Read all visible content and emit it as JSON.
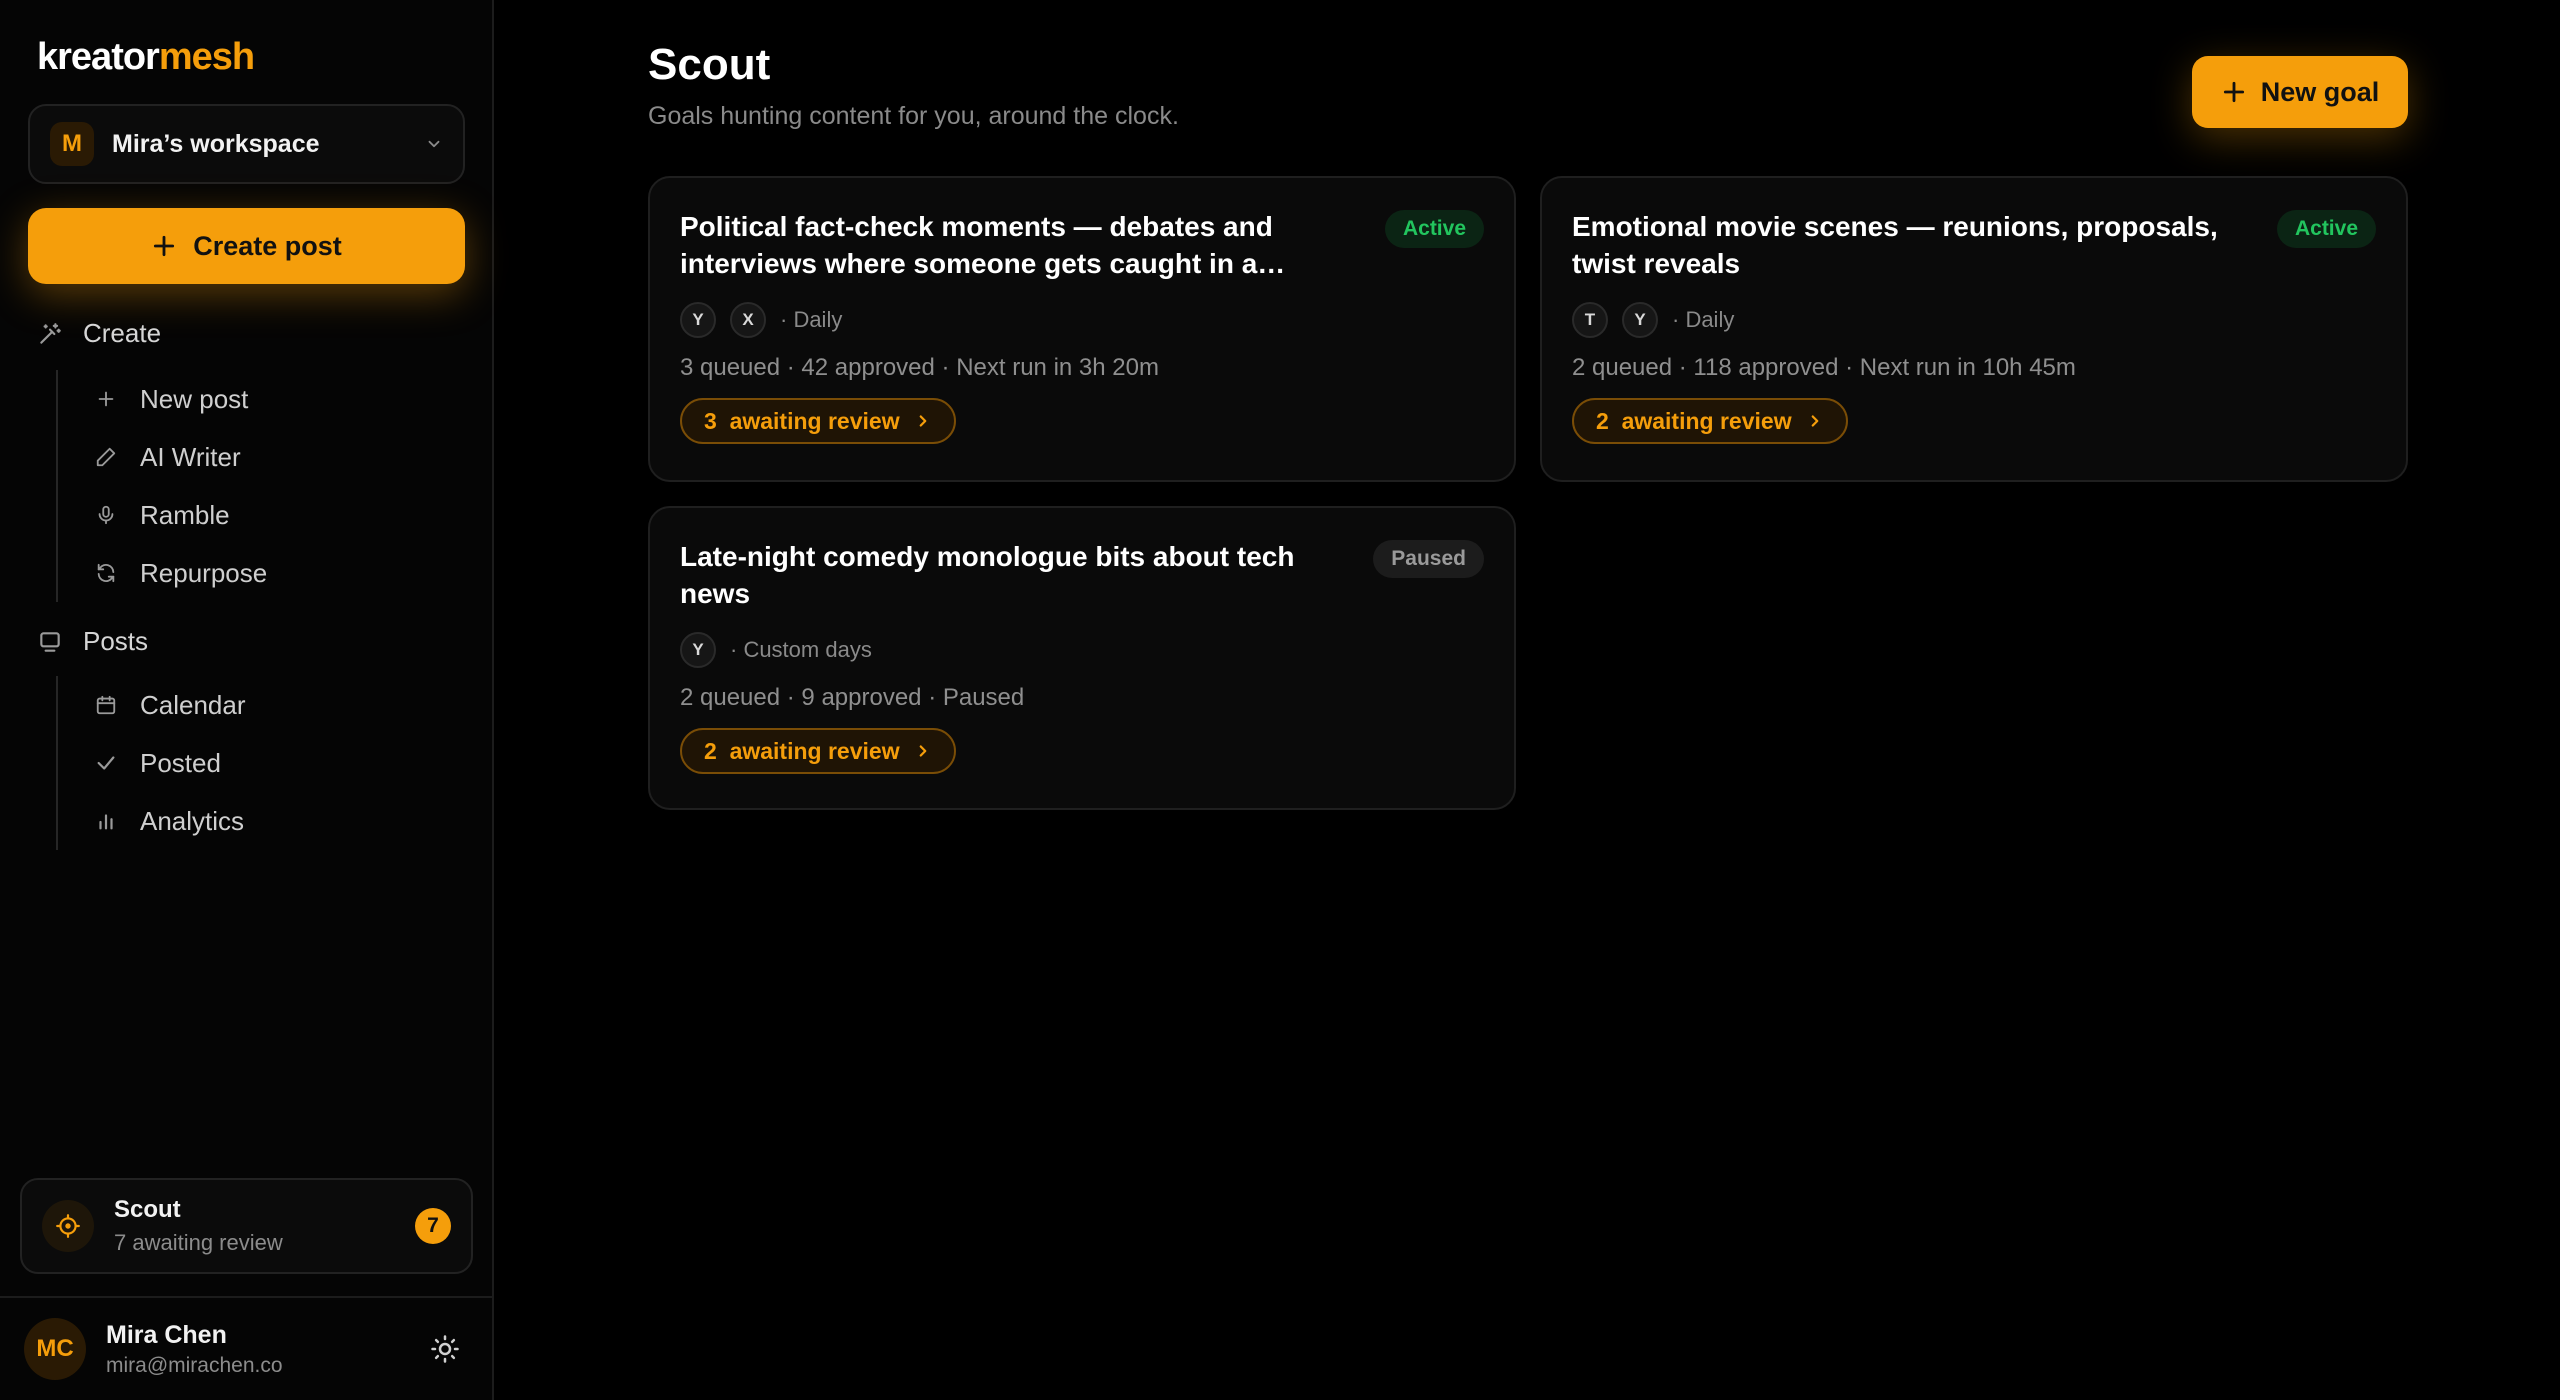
{
  "brand": {
    "part1": "kreator",
    "part2": "mesh",
    "accent": "#f59e0b"
  },
  "workspace": {
    "initial": "M",
    "name": "Mira’s workspace"
  },
  "sidebar": {
    "create_post": "Create post",
    "sections": [
      {
        "label": "Create",
        "items": [
          "New post",
          "AI Writer",
          "Ramble",
          "Repurpose"
        ]
      },
      {
        "label": "Posts",
        "items": [
          "Calendar",
          "Posted",
          "Analytics"
        ]
      }
    ]
  },
  "scout_widget": {
    "title": "Scout",
    "subtitle": "7 awaiting review",
    "count": "7"
  },
  "user": {
    "initials": "MC",
    "name": "Mira Chen",
    "email": "mira@mirachen.co"
  },
  "page": {
    "title": "Scout",
    "subtitle": "Goals hunting content for you, around the clock.",
    "new_goal": "New goal"
  },
  "goals": [
    {
      "title": "Political fact-check moments — debates and interviews where someone gets caught in a…",
      "status": "Active",
      "platforms": [
        "Y",
        "X"
      ],
      "schedule": "· Daily",
      "stats": "3 queued · 42 approved · Next run in 3h 20m",
      "review": "3  awaiting review"
    },
    {
      "title": "Emotional movie scenes — reunions, proposals, twist reveals",
      "status": "Active",
      "platforms": [
        "T",
        "Y"
      ],
      "schedule": "· Daily",
      "stats": "2 queued · 118 approved · Next run in 10h 45m",
      "review": "2  awaiting review"
    },
    {
      "title": "Late-night comedy monologue bits about tech news",
      "status": "Paused",
      "platforms": [
        "Y"
      ],
      "schedule": "· Custom days",
      "stats": "2 queued · 9 approved · Paused",
      "review": "2  awaiting review"
    }
  ]
}
